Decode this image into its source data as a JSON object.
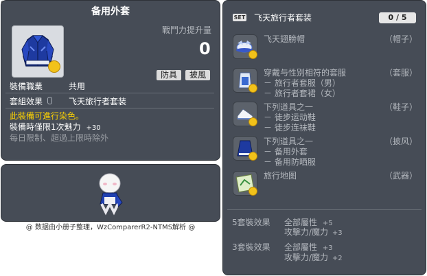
{
  "item_id": "01103735",
  "left": {
    "title": "备用外套",
    "power_label": "戰鬥力提升量",
    "power_value": "0",
    "tags": [
      "防具",
      "披風"
    ],
    "job_label": "裝備職業",
    "job_value": "共用",
    "set_label": "套組效果",
    "set_value": "飞天旅行者套装",
    "dye_text": "此裝備可進行染色。",
    "charm_text": "裝備時僅限1次魅力",
    "charm_value": "+30",
    "limit_text": "每日限制、超過上限時除外"
  },
  "credit": "@ 数据由小册子整理，WzComparerR2-NTMS解析 @",
  "right": {
    "set_badge": "SET",
    "title": "飞天旅行者套装",
    "count": "0 / 5",
    "items": [
      {
        "icon": "hat-icon",
        "lines": [
          "飞天翅膀帽"
        ],
        "slot": "（帽子）"
      },
      {
        "icon": "overall-icon",
        "lines": [
          "穿戴与性别相符的套服",
          "－ 旅行者套服（男）",
          "－ 旅行者套裙（女）"
        ],
        "slot": "（套服）"
      },
      {
        "icon": "shoes-icon",
        "lines": [
          "下列道具之一",
          "－ 徒步运动鞋",
          "－ 徒步连袜鞋"
        ],
        "slot": "（鞋子）"
      },
      {
        "icon": "cape-icon",
        "lines": [
          "下列道具之一",
          "－ 备用外套",
          "－ 备用防晒服"
        ],
        "slot": "（披风）"
      },
      {
        "icon": "map-icon",
        "lines": [
          "旅行地图"
        ],
        "slot": "（武器）"
      }
    ],
    "effects": [
      {
        "label": "5套裝效果",
        "stats": [
          {
            "name": "全部屬性",
            "value": "+5"
          },
          {
            "name": "攻擊力/魔力",
            "value": "+3"
          }
        ]
      },
      {
        "label": "3套裝效果",
        "stats": [
          {
            "name": "全部屬性",
            "value": "+3"
          },
          {
            "name": "攻擊力/魔力",
            "value": "+2"
          }
        ]
      }
    ]
  },
  "colors": {
    "panel": "#464c56",
    "yellow": "#ffd400",
    "dim": "#b3b7bd"
  }
}
